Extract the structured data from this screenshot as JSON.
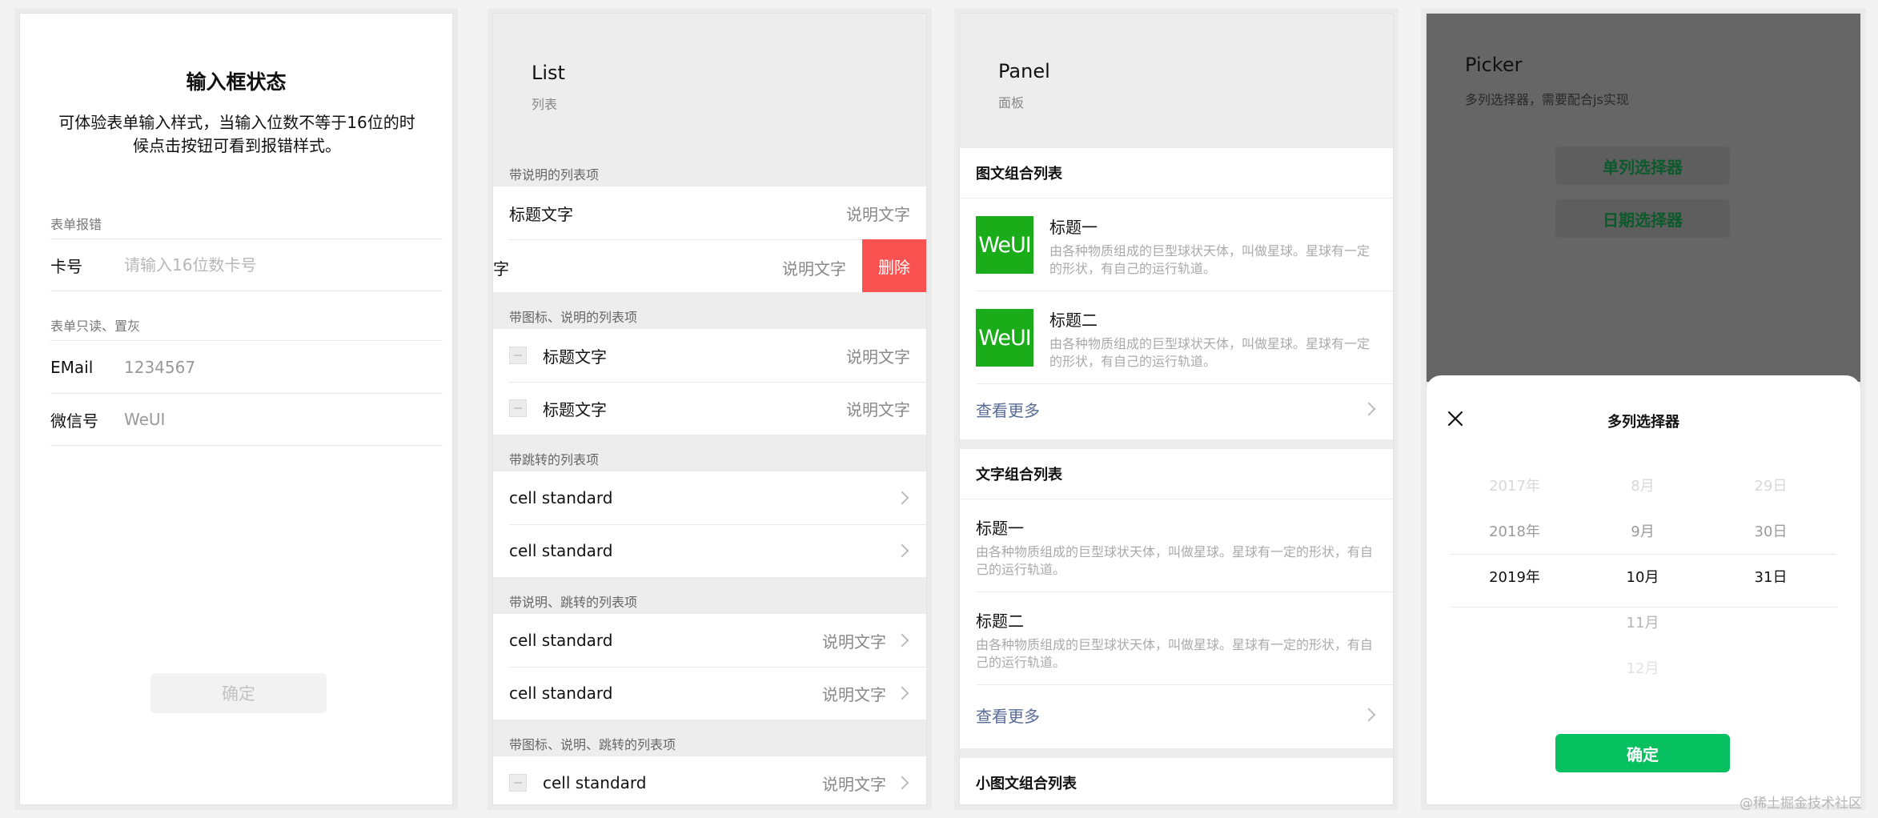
{
  "form": {
    "title": "输入框状态",
    "description": "可体验表单输入样式，当输入位数不等于16位的时候点击按钮可看到报错样式。",
    "group_error": "表单报错",
    "card_label": "卡号",
    "card_placeholder": "请输入16位数卡号",
    "group_readonly": "表单只读、置灰",
    "email_label": "EMail",
    "email_value": "1234567",
    "wechat_label": "微信号",
    "wechat_value": "WeUI",
    "confirm_label": "确定"
  },
  "list": {
    "title": "List",
    "subtitle": "列表",
    "sec1": "带说明的列表项",
    "cell_title": "标题文字",
    "cell_desc": "说明文字",
    "swipe_fragment": "字",
    "delete_label": "删除",
    "sec2": "带图标、说明的列表项",
    "sec3": "带跳转的列表项",
    "standard": "cell standard",
    "sec4": "带说明、跳转的列表项",
    "sec5": "带图标、说明、跳转的列表项"
  },
  "panel": {
    "title": "Panel",
    "subtitle": "面板",
    "media_header": "图文组合列表",
    "thumb_text": "WeUI",
    "item1_title": "标题一",
    "item2_title": "标题二",
    "item_desc": "由各种物质组成的巨型球状天体，叫做星球。星球有一定的形状，有自己的运行轨道。",
    "more_label": "查看更多",
    "text_header": "文字组合列表",
    "small_header": "小图文组合列表"
  },
  "picker": {
    "title": "Picker",
    "subtitle": "多列选择器，需要配合js实现",
    "single_label": "单列选择器",
    "date_label": "日期选择器",
    "sheet_title": "多列选择器",
    "years": [
      "2017年",
      "2018年",
      "2019年"
    ],
    "months": [
      "8月",
      "9月",
      "10月",
      "11月",
      "12月"
    ],
    "days": [
      "29日",
      "30日",
      "31日"
    ],
    "confirm_label": "确定"
  },
  "watermark": "@稀土掘金技术社区",
  "colors": {
    "brand_green": "#07c160",
    "thumb_green": "#1aad19",
    "danger_red": "#fa5151",
    "link_blue": "#576b95"
  }
}
